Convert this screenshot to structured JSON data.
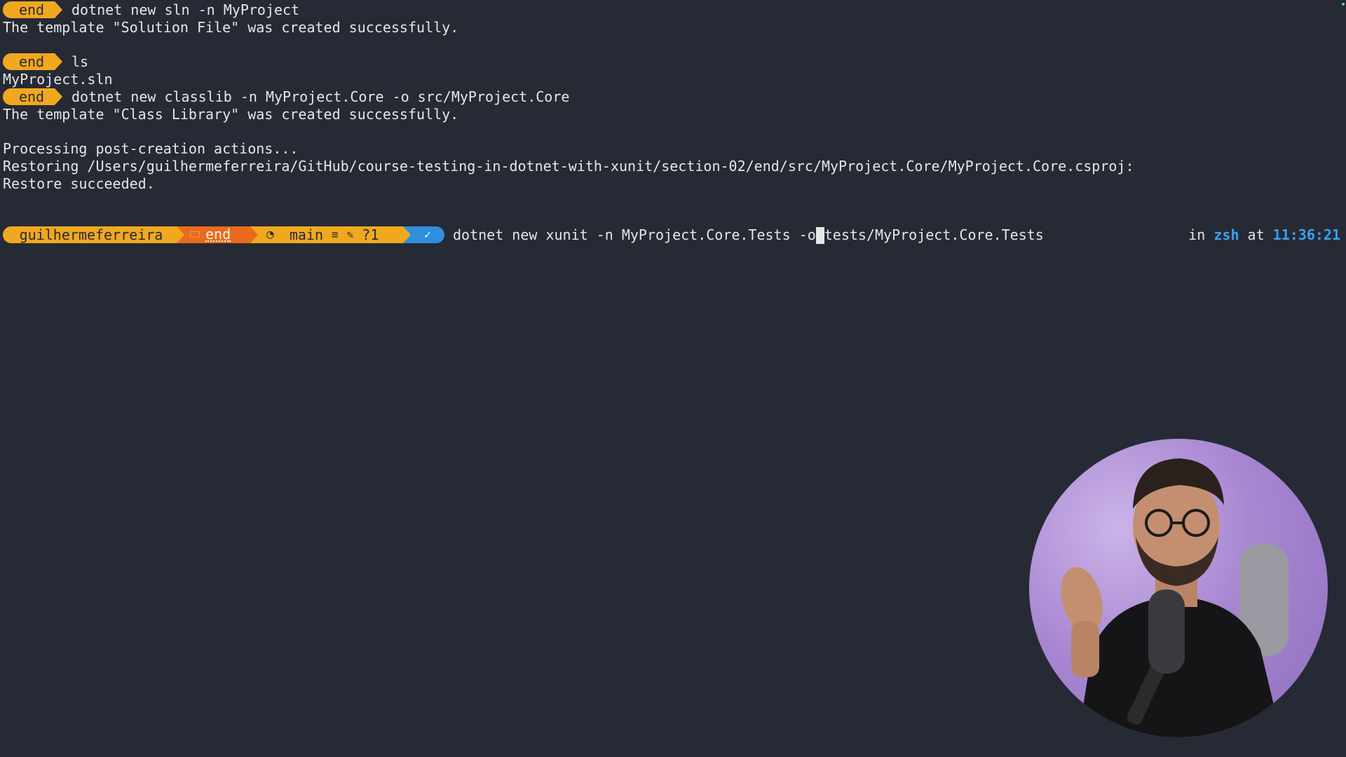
{
  "prompt_short_label": "end",
  "lines": {
    "cmd1": "dotnet new sln -n MyProject",
    "out1": "The template \"Solution File\" was created successfully.",
    "cmd2": "ls",
    "out2": "MyProject.sln",
    "cmd3": "dotnet new classlib -n MyProject.Core -o src/MyProject.Core",
    "out3": "The template \"Class Library\" was created successfully.",
    "out4": "Processing post-creation actions...",
    "out5": "Restoring /Users/guilhermeferreira/GitHub/course-testing-in-dotnet-with-xunit/section-02/end/src/MyProject.Core/MyProject.Core.csproj:",
    "out6": "Restore succeeded."
  },
  "current_prompt": {
    "user": "guilhermeferreira",
    "folder_icon": "folder-icon",
    "dir": "end",
    "git_icon": "github-icon",
    "branch": "main",
    "stat_equal": "≡",
    "stat_edit": "✎",
    "stat_untracked": "?1",
    "ok_mark": "✓",
    "command_before_cursor": "dotnet new xunit -n MyProject.Core.Tests -o",
    "command_after_cursor": "tests/MyProject.Core.Tests"
  },
  "right_prompt": {
    "in": "in",
    "shell": "zsh",
    "at": "at",
    "time": "11:36:21"
  },
  "colors": {
    "background": "#262a35",
    "prompt_yellow": "#f0a81f",
    "prompt_orange": "#ea6a1c",
    "prompt_blue": "#2f8fdc",
    "accent_blue_text": "#3aa2ee"
  }
}
